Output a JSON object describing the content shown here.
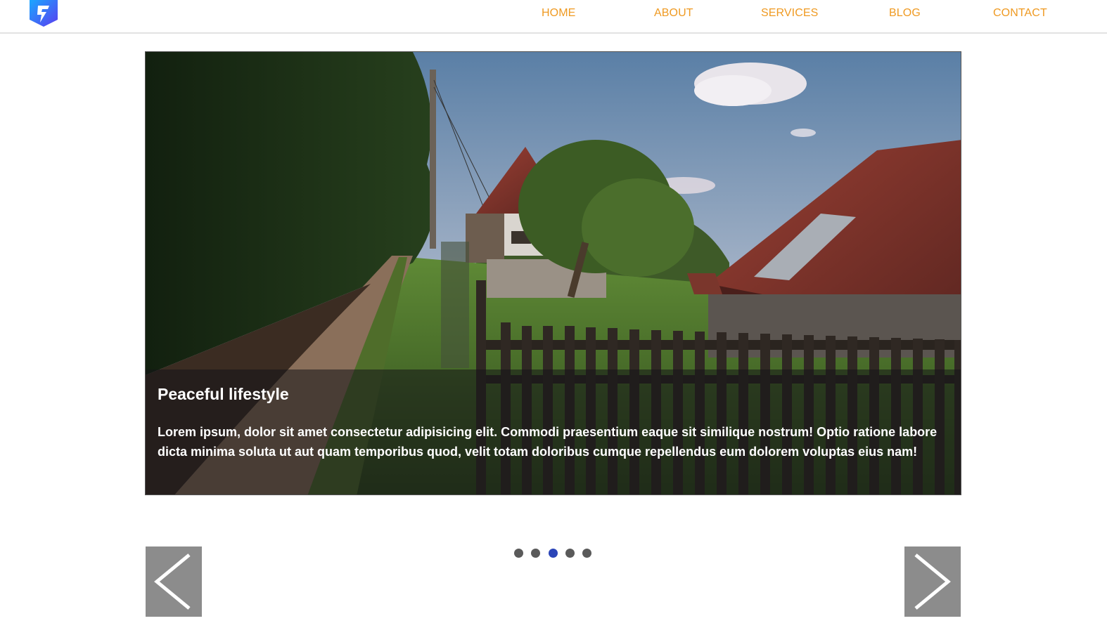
{
  "header": {
    "logo_icon": "lightning-shield-logo",
    "nav": [
      {
        "label": "HOME"
      },
      {
        "label": "ABOUT"
      },
      {
        "label": "SERVICES"
      },
      {
        "label": "BLOG"
      },
      {
        "label": "CONTACT"
      }
    ],
    "nav_color": "#ef9a22"
  },
  "slider": {
    "caption_title": "Peaceful lifestyle",
    "caption_text": "Lorem ipsum, dolor sit amet consectetur adipisicing elit. Commodi praesentium eaque sit similique nostrum! Optio ratione labore dicta minima soluta ut aut quam temporibus quod, velit totam doloribus cumque repellendus eum dolorem voluptas eius nam!",
    "image": "village-path-houses-fence-photo",
    "slide_count": 5,
    "active_slide": 3,
    "prev_icon": "chevron-left-icon",
    "next_icon": "chevron-right-icon",
    "active_dot_color": "#2b45b8"
  }
}
